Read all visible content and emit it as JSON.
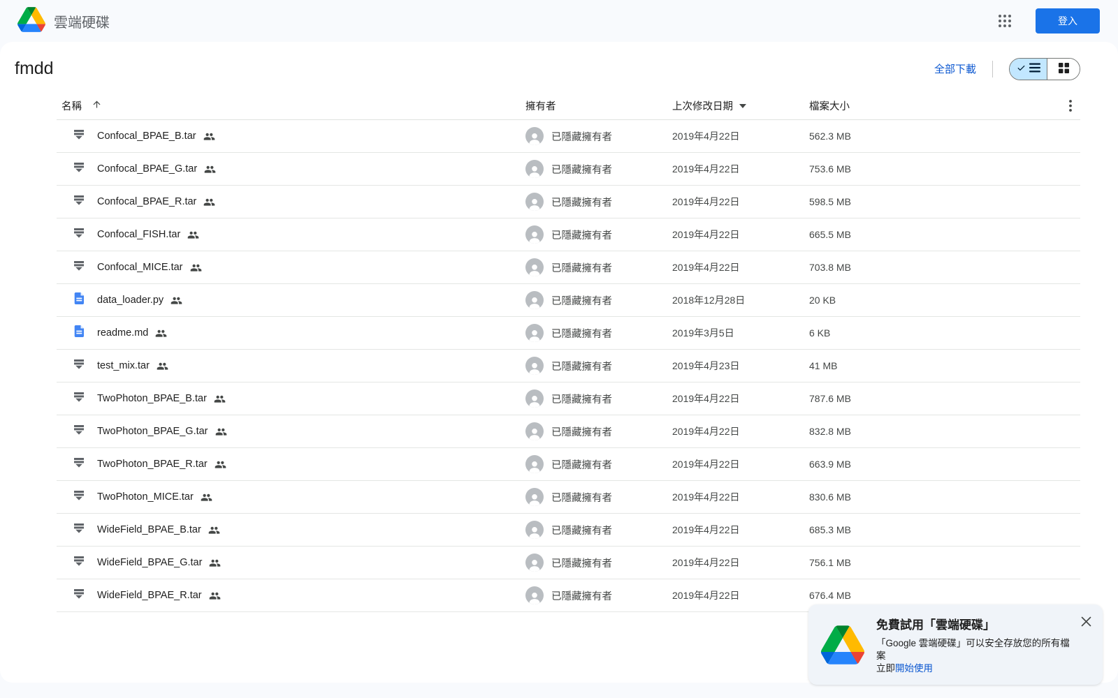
{
  "header": {
    "app_title": "雲端硬碟",
    "signin_label": "登入"
  },
  "toolbar": {
    "folder_title": "fmdd",
    "download_all_label": "全部下載"
  },
  "table": {
    "headers": {
      "name": "名稱",
      "owner": "擁有者",
      "modified": "上次修改日期",
      "size": "檔案大小"
    },
    "owner_hidden_label": "已隱藏擁有者",
    "rows": [
      {
        "name": "Confocal_BPAE_B.tar",
        "type": "archive",
        "modified": "2019年4月22日",
        "size": "562.3 MB"
      },
      {
        "name": "Confocal_BPAE_G.tar",
        "type": "archive",
        "modified": "2019年4月22日",
        "size": "753.6 MB"
      },
      {
        "name": "Confocal_BPAE_R.tar",
        "type": "archive",
        "modified": "2019年4月22日",
        "size": "598.5 MB"
      },
      {
        "name": "Confocal_FISH.tar",
        "type": "archive",
        "modified": "2019年4月22日",
        "size": "665.5 MB"
      },
      {
        "name": "Confocal_MICE.tar",
        "type": "archive",
        "modified": "2019年4月22日",
        "size": "703.8 MB"
      },
      {
        "name": "data_loader.py",
        "type": "document",
        "modified": "2018年12月28日",
        "size": "20 KB"
      },
      {
        "name": "readme.md",
        "type": "document",
        "modified": "2019年3月5日",
        "size": "6 KB"
      },
      {
        "name": "test_mix.tar",
        "type": "archive",
        "modified": "2019年4月23日",
        "size": "41 MB"
      },
      {
        "name": "TwoPhoton_BPAE_B.tar",
        "type": "archive",
        "modified": "2019年4月22日",
        "size": "787.6 MB"
      },
      {
        "name": "TwoPhoton_BPAE_G.tar",
        "type": "archive",
        "modified": "2019年4月22日",
        "size": "832.8 MB"
      },
      {
        "name": "TwoPhoton_BPAE_R.tar",
        "type": "archive",
        "modified": "2019年4月22日",
        "size": "663.9 MB"
      },
      {
        "name": "TwoPhoton_MICE.tar",
        "type": "archive",
        "modified": "2019年4月22日",
        "size": "830.6 MB"
      },
      {
        "name": "WideField_BPAE_B.tar",
        "type": "archive",
        "modified": "2019年4月22日",
        "size": "685.3 MB"
      },
      {
        "name": "WideField_BPAE_G.tar",
        "type": "archive",
        "modified": "2019年4月22日",
        "size": "756.1 MB"
      },
      {
        "name": "WideField_BPAE_R.tar",
        "type": "archive",
        "modified": "2019年4月22日",
        "size": "676.4 MB"
      }
    ]
  },
  "promo": {
    "title": "免費試用「雲端硬碟」",
    "body_line1": "「Google 雲端硬碟」可以安全存放您的所有檔案",
    "cta_prefix": "立即",
    "cta_link_label": "開始使用"
  },
  "icons": {
    "drive_logo": "google-drive-triangle",
    "apps": "3x3-dot-grid",
    "list_view": "checkmark-plus-list",
    "grid_view": "2x2-squares",
    "sort_ascending": "arrow-up",
    "sort_menu": "triangle-down",
    "more_options": "vertical-kebab",
    "archive_file": "gray-stacked-bars",
    "document_file": "blue-page-with-lines",
    "shared": "two-people",
    "hidden_owner": "gray-person-avatar",
    "close": "x-mark"
  },
  "colors": {
    "accent_blue": "#1a73e8",
    "link_blue": "#0b57d0",
    "toggle_selected_bg": "#c2e7ff",
    "page_bg": "#f8fafd",
    "promo_bg": "#f0f4f9"
  }
}
